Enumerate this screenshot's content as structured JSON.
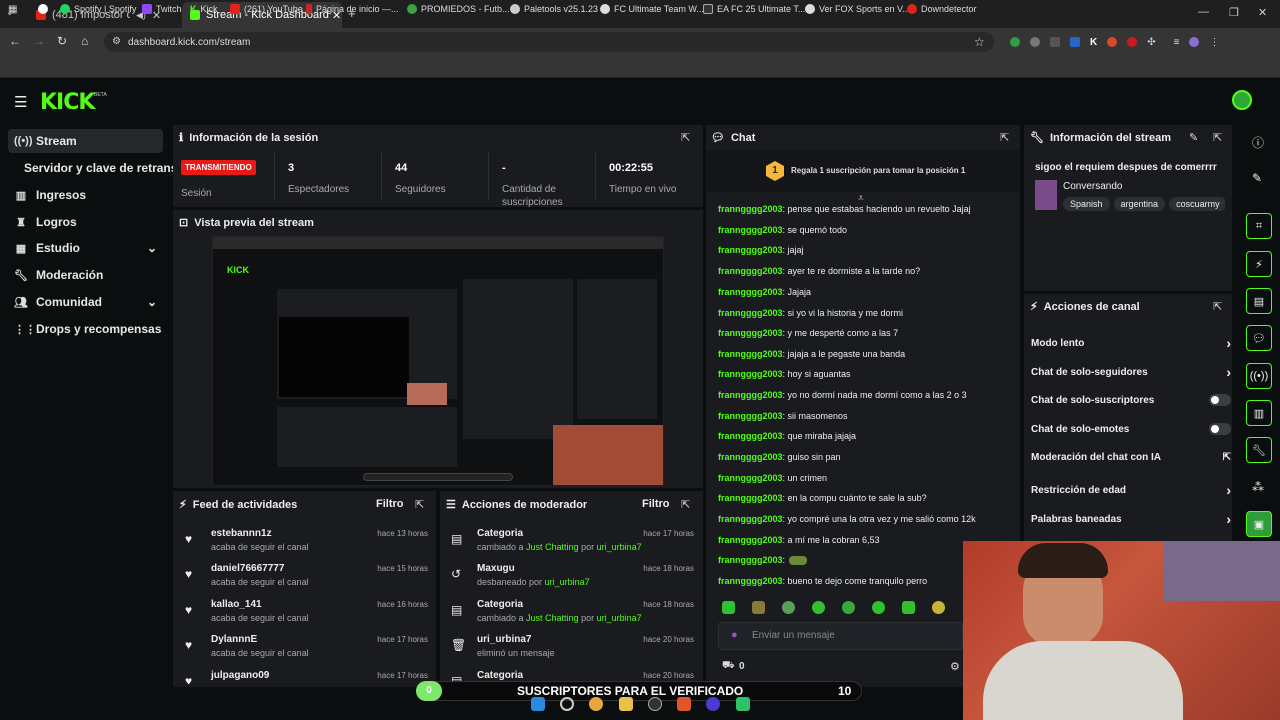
{
  "browser": {
    "tabs": [
      {
        "label": "(481) Impostor de Policía | A"
      },
      {
        "label": "Stream - Kick Dashboard"
      }
    ],
    "url": "dashboard.kick.com/stream",
    "bookmarks": [
      "Spotify | Spotify",
      "Twitch",
      "Kick",
      "(261) YouTube",
      "Página de inicio —...",
      "PROMIEDOS - Futb...",
      "Paletools v25.1.23",
      "FC Ultimate Team W...",
      "EA FC 25 Ultimate T...",
      "Ver FOX Sports en V...",
      "Downdetector"
    ]
  },
  "app": {
    "logo": "KICK",
    "logo_badge": "BETA"
  },
  "sidebar": {
    "items": [
      {
        "label": "Stream",
        "icon": "broadcast-icon"
      },
      {
        "label": "Servidor y clave de retransm"
      },
      {
        "label": "Ingresos",
        "icon": "chart-icon"
      },
      {
        "label": "Logros",
        "icon": "trophy-icon"
      },
      {
        "label": "Estudio",
        "icon": "studio-icon"
      },
      {
        "label": "Moderación",
        "icon": "wrench-icon"
      },
      {
        "label": "Comunidad",
        "icon": "people-icon"
      },
      {
        "label": "Drops y recompensas",
        "icon": "gift-icon"
      }
    ]
  },
  "session": {
    "title": "Información de la sesión",
    "status_badge": "TRANSMITIENDO",
    "status_label": "Sesión",
    "stats": [
      {
        "value": "3",
        "label": "Espectadores"
      },
      {
        "value": "44",
        "label": "Seguidores"
      },
      {
        "value": "-",
        "label": "Cantidad de suscripciones"
      },
      {
        "value": "00:22:55",
        "label": "Tiempo en vivo"
      }
    ]
  },
  "preview": {
    "title": "Vista previa del stream"
  },
  "feed": {
    "title": "Feed de actividades",
    "filter": "Filtro",
    "items": [
      {
        "name": "estebannn1z",
        "sub": "acaba de seguir el canal",
        "time": "hace 13 horas"
      },
      {
        "name": "daniel76667777",
        "sub": "acaba de seguir el canal",
        "time": "hace 15 horas"
      },
      {
        "name": "kallao_141",
        "sub": "acaba de seguir el canal",
        "time": "hace 16 horas"
      },
      {
        "name": "DylannnE",
        "sub": "acaba de seguir el canal",
        "time": "hace 17 horas"
      },
      {
        "name": "julpagano09",
        "sub": "",
        "time": "hace 17 horas"
      }
    ]
  },
  "mod": {
    "title": "Acciones de moderador",
    "filter": "Filtro",
    "items": [
      {
        "name": "Categoria",
        "pre": "cambiado a ",
        "hl": "Just Chatting",
        "mid": " por ",
        "user": "uri_urbina7",
        "time": "hace 17 horas"
      },
      {
        "name": "Maxugu",
        "pre": "desbaneado por ",
        "hl": "",
        "mid": "",
        "user": "uri_urbina7",
        "time": "hace 18 horas"
      },
      {
        "name": "Categoria",
        "pre": "cambiado a ",
        "hl": "Just Chatting",
        "mid": " por ",
        "user": "uri_urbina7",
        "time": "hace 18 horas"
      },
      {
        "name": "uri_urbina7",
        "pre": "eliminó un mensaje",
        "hl": "",
        "mid": "",
        "user": "",
        "time": "hace 20 horas"
      },
      {
        "name": "Categoria",
        "pre": "",
        "hl": "",
        "mid": "",
        "user": "",
        "time": "hace 20 horas"
      }
    ]
  },
  "chat": {
    "title": "Chat",
    "gift_badge": "1",
    "gift_text": "Regala 1 suscripción para tomar la posición 1",
    "input_placeholder": "Enviar un mensaje",
    "count": "0",
    "messages": [
      {
        "user": "franngggg2003",
        "text": ": pense que estabas haciendo un revuelto Jajaj"
      },
      {
        "user": "franngggg2003",
        "text": ": se quemó todo"
      },
      {
        "user": "franngggg2003",
        "text": ": jajaj"
      },
      {
        "user": "franngggg2003",
        "text": ": ayer te re dormiste a la tarde no?"
      },
      {
        "user": "franngggg2003",
        "text": ": Jajaja"
      },
      {
        "user": "franngggg2003",
        "text": ": si yo vi la historia y me dormi"
      },
      {
        "user": "franngggg2003",
        "text": ": y me desperté como a las 7"
      },
      {
        "user": "franngggg2003",
        "text": ": jajaja a le pegaste una banda"
      },
      {
        "user": "franngggg2003",
        "text": ": hoy si aguantas"
      },
      {
        "user": "franngggg2003",
        "text": ": yo no dormí nada me dormí como a las 2 o 3"
      },
      {
        "user": "franngggg2003",
        "text": ": sii masomenos"
      },
      {
        "user": "franngggg2003",
        "text": ": que miraba jajaja"
      },
      {
        "user": "franngggg2003",
        "text": ": guiso sin pan"
      },
      {
        "user": "franngggg2003",
        "text": ": un crimen"
      },
      {
        "user": "franngggg2003",
        "text": ": en la compu cuánto te sale la sub?"
      },
      {
        "user": "franngggg2003",
        "text": ": yo compré una la otra vez y me salió como 12k"
      },
      {
        "user": "franngggg2003",
        "text": ": a mí me la cobran 6,53"
      },
      {
        "user": "franngggg2003",
        "text": ":"
      },
      {
        "user": "franngggg2003",
        "text": ": bueno te dejo come tranquilo perro"
      }
    ]
  },
  "stream_info": {
    "title": "Información del stream",
    "stream_title": "sigoo el requiem despues de comerrrr",
    "category": "Conversando",
    "tags": [
      "Spanish",
      "argentina",
      "coscuarmy"
    ]
  },
  "channel_actions": {
    "title": "Acciones de canal",
    "items": [
      {
        "label": "Modo lento",
        "kind": "arrow"
      },
      {
        "label": "Chat de solo-seguidores",
        "kind": "arrow"
      },
      {
        "label": "Chat de solo-suscriptores",
        "kind": "toggle"
      },
      {
        "label": "Chat de solo-emotes",
        "kind": "toggle"
      },
      {
        "label": "Moderación del chat con IA",
        "kind": "ext"
      },
      {
        "label": "Restricción de edad",
        "kind": "arrow"
      },
      {
        "label": "Palabras baneadas",
        "kind": "arrow"
      }
    ]
  },
  "overlay_bar": {
    "left_value": "0",
    "label": "SUSCRIPTORES PARA EL VERIFICADO",
    "right_value": "10"
  },
  "colors": {
    "accent": "#53fc18",
    "live_badge": "#e91916",
    "panel": "#191b1f",
    "bg": "#0b0e0f"
  }
}
